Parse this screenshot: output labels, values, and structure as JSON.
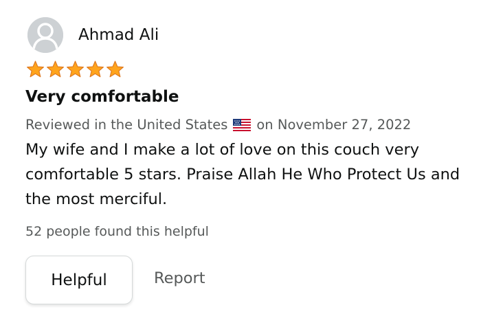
{
  "review": {
    "reviewer_name": "Ahmad Ali",
    "avatar_icon": "user-silhouette-icon",
    "rating": 5,
    "rating_max": 5,
    "star_color": "#ffa41c",
    "title": "Very comfortable",
    "meta_prefix": "Reviewed in the United States",
    "flag_icon": "us-flag-icon",
    "meta_suffix": "on November 27, 2022",
    "body": "My wife and I make a lot of love on this couch very comfortable 5 stars. Praise Allah He Who Protect Us and the most merciful.",
    "helpful_count_text": "52 people found this helpful",
    "helpful_button_label": "Helpful",
    "report_label": "Report"
  },
  "colors": {
    "text_primary": "#0f1111",
    "text_secondary": "#565959",
    "avatar_bg": "#cdd1d4",
    "button_border": "#d5d9d9"
  }
}
